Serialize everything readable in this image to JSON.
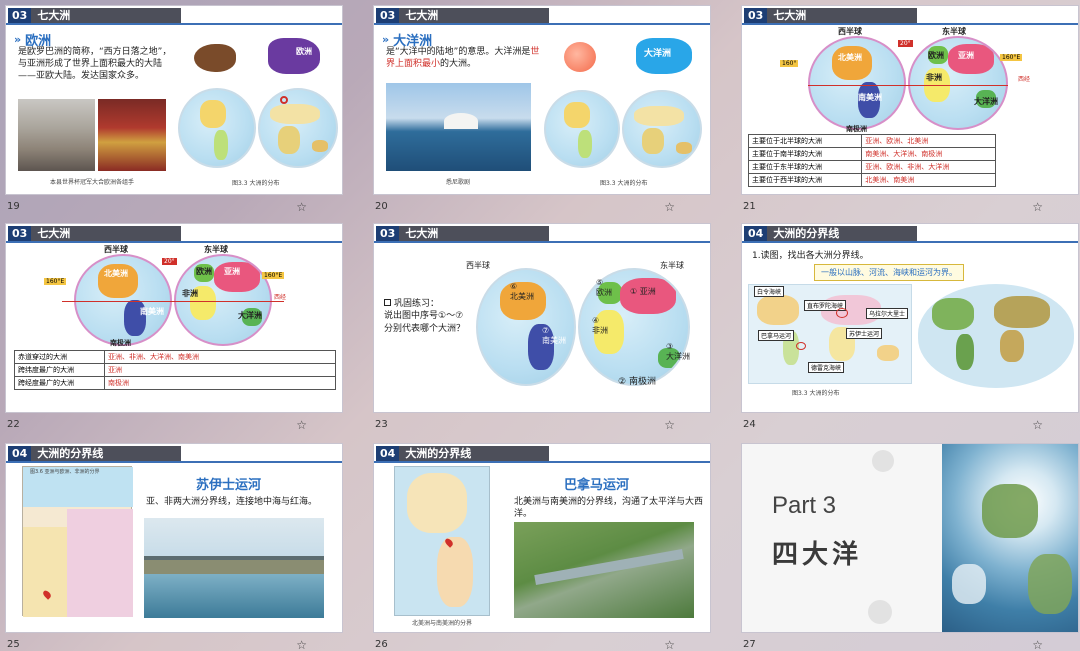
{
  "slides": [
    {
      "num": "19",
      "badge": "03",
      "title": "七大洲",
      "heading": "欧洲",
      "body": "是欧罗巴洲的简称，“西方日落之地”，与亚洲形成了世界上面积最大的大陆——亚欧大陆。发达国家众多。",
      "label": "欧洲",
      "caption": "本县世界杯冠军大合欧洲各组手",
      "mapcap": "图3.3 大洲的分布"
    },
    {
      "num": "20",
      "badge": "03",
      "title": "七大洲",
      "heading": "大洋洲",
      "body_pre": "是“大洋中的陆地”的意思。大洋洲是",
      "body_red": "世界上面积最小",
      "body_post": "的大洲。",
      "label": "大洋洲",
      "caption": "悉尼歌剧",
      "mapcap": "图3.3 大洲的分布"
    },
    {
      "num": "21",
      "badge": "03",
      "title": "七大洲",
      "west": "西半球",
      "east": "东半球",
      "deg20": "20°",
      "deg160a": "160°",
      "deg160b": "160°E",
      "xi": "西经",
      "na": "北美洲",
      "sa": "南美洲",
      "eu": "欧洲",
      "as": "亚洲",
      "af": "非洲",
      "oc": "大洋洲",
      "an": "南极洲",
      "rows": [
        {
          "k": "主要位于北半球的大洲",
          "v": "亚洲、欧洲、北美洲"
        },
        {
          "k": "主要位于南半球的大洲",
          "v": "南美洲、大洋洲、南极洲"
        },
        {
          "k": "主要位于东半球的大洲",
          "v": "亚洲、欧洲、非洲、大洋洲"
        },
        {
          "k": "主要位于西半球的大洲",
          "v": "北美洲、南美洲"
        }
      ]
    },
    {
      "num": "22",
      "badge": "03",
      "title": "七大洲",
      "west": "西半球",
      "east": "东半球",
      "deg20": "20°",
      "deg160a": "160°E",
      "deg160b": "160°E",
      "xi": "西经",
      "na": "北美洲",
      "sa": "南美洲",
      "eu": "欧洲",
      "as": "亚洲",
      "af": "非洲",
      "oc": "大洋洲",
      "an": "南极洲",
      "rows": [
        {
          "k": "赤道穿过的大洲",
          "v": "亚洲、非洲、大洋洲、南美洲"
        },
        {
          "k": "跨纬度最广的大洲",
          "v": "亚洲"
        },
        {
          "k": "跨经度最广的大洲",
          "v": "南极洲"
        }
      ]
    },
    {
      "num": "23",
      "badge": "03",
      "title": "七大洲",
      "west": "西半球",
      "east": "东半球",
      "q_title": "巩固练习：",
      "q_body": "说出图中序号①～⑦分别代表哪个大洲？",
      "n6": "⑥",
      "n6l": "北美洲",
      "n7": "⑦",
      "n7l": "南美洲",
      "n5": "⑤",
      "n5l": "欧洲",
      "n1": "①",
      "n1l": "亚洲",
      "n4": "④",
      "n4l": "非洲",
      "n3": "③",
      "n3l": "大洋洲",
      "n2": "②",
      "n2l": "南极洲"
    },
    {
      "num": "24",
      "badge": "04",
      "title": "大洲的分界线",
      "task": "1.读图，找出各大洲分界线。",
      "hint": "一般以山脉、河流、海峡和运河为界。",
      "tags": [
        "白令海峡",
        "直布罗陀海峡",
        "乌拉尔大里士",
        "巴拿马运河",
        "苏伊士运河",
        "德雷克海峡"
      ],
      "mapcap": "图3.3 大洲的分布"
    },
    {
      "num": "25",
      "badge": "04",
      "title": "大洲的分界线",
      "heading": "苏伊士运河",
      "body": "亚、非两大洲分界线，连接地中海与红海。",
      "mapcap": "图3.6 亚洲与欧洲、非洲的分界"
    },
    {
      "num": "26",
      "badge": "04",
      "title": "大洲的分界线",
      "heading": "巴拿马运河",
      "body": "北美洲与南美洲的分界线，沟通了太平洋与大西洋。",
      "mapcap": "北美洲与南美洲的分界"
    },
    {
      "num": "27",
      "part": "Part 3",
      "name": "四大洋"
    }
  ],
  "colors": {
    "badge": "#1d3e74",
    "accent": "#2b6fc0",
    "red": "#d0302a"
  }
}
